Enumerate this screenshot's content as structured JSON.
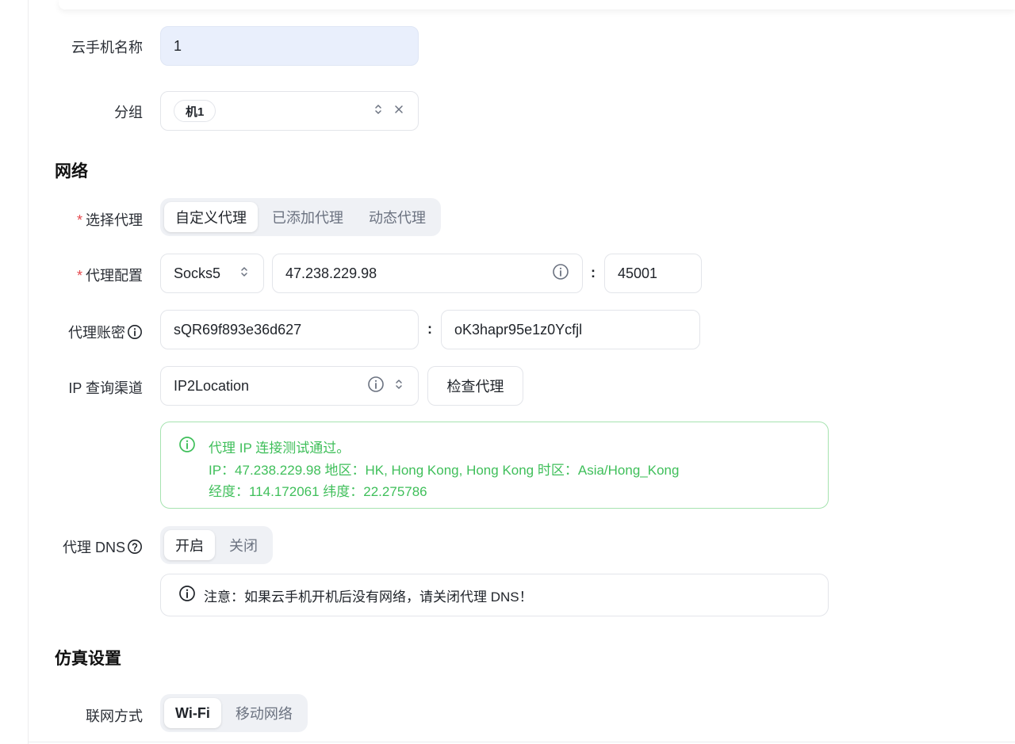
{
  "form": {
    "name_label": "云手机名称",
    "name_value": "1",
    "group_label": "分组",
    "group_tag": "机1"
  },
  "network": {
    "section_title": "网络",
    "proxy_select_label": "选择代理",
    "proxy_modes": [
      "自定义代理",
      "已添加代理",
      "动态代理"
    ],
    "proxy_mode_active": "自定义代理",
    "proxy_config_label": "代理配置",
    "protocol": "Socks5",
    "host": "47.238.229.98",
    "port": "45001",
    "account_label": "代理账密",
    "username": "sQR69f893e36d627",
    "password": "oK3hapr95e1z0Ycfjl",
    "ip_channel_label": "IP 查询渠道",
    "ip_channel": "IP2Location",
    "check_button": "检查代理",
    "result_line1": "代理 IP 连接测试通过。",
    "result_line2": "IP：47.238.229.98  地区：HK, Hong Kong, Hong Kong  时区：Asia/Hong_Kong",
    "result_line3": "经度：114.172061  纬度：22.275786",
    "dns_label": "代理 DNS",
    "dns_options": [
      "开启",
      "关闭"
    ],
    "dns_active": "开启",
    "dns_note": "注意：如果云手机开机后没有网络，请关闭代理 DNS！",
    "colon": ":"
  },
  "emulation": {
    "section_title": "仿真设置",
    "network_type_label": "联网方式",
    "network_types": [
      "Wi-Fi",
      "移动网络"
    ],
    "network_type_active": "Wi-Fi"
  },
  "colors": {
    "success_green": "#3fbf5a",
    "required_red": "#e5484d",
    "input_filled_bg": "#e9effc"
  }
}
